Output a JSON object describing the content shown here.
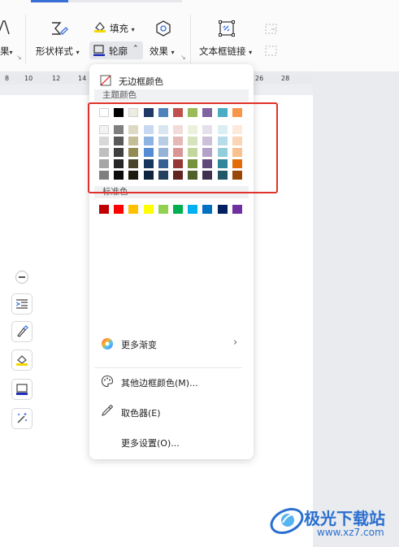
{
  "ribbon": {
    "cut_text": "果",
    "shape_style": "形状样式",
    "fill": "填充",
    "outline": "轮廓",
    "effect": "效果",
    "text_link": "文本框链接"
  },
  "ruler": {
    "numbers": [
      "8",
      "10",
      "12",
      "14",
      "28",
      "26"
    ]
  },
  "menu": {
    "no_border_color": "无边框颜色",
    "theme_colors_label": "主题颜色",
    "standard_colors_label": "标准色",
    "more_gradient": "更多渐变",
    "other_border_colors": "其他边框颜色(M)...",
    "eyedropper": "取色器(E)",
    "more_settings": "更多设置(O)..."
  },
  "theme_colors": {
    "top_row": [
      "#ffffff",
      "#000000",
      "#eeece1",
      "#1f3864",
      "#4f81bd",
      "#c0504d",
      "#9bbb59",
      "#8064a2",
      "#4bacc6",
      "#f79646"
    ],
    "shade_rows": [
      [
        "#f2f2f2",
        "#7f7f7f",
        "#ddd9c3",
        "#c6d9f0",
        "#dbe5f1",
        "#f2dcdb",
        "#ebf1dd",
        "#e5e0ec",
        "#dbeef3",
        "#fdeada"
      ],
      [
        "#d8d8d8",
        "#595959",
        "#c4bd97",
        "#8db3e2",
        "#b8cce4",
        "#e5b9b7",
        "#d7e3bc",
        "#ccc1d9",
        "#b7dde8",
        "#fbd5b5"
      ],
      [
        "#bfbfbf",
        "#3f3f3f",
        "#938953",
        "#548dd4",
        "#95b3d7",
        "#d99694",
        "#c3d69b",
        "#b2a2c7",
        "#92cddc",
        "#fac08f"
      ],
      [
        "#a5a5a5",
        "#262626",
        "#494429",
        "#17365d",
        "#366092",
        "#953734",
        "#76923c",
        "#5f497a",
        "#31859b",
        "#e36c09"
      ],
      [
        "#7f7f7f",
        "#0c0c0c",
        "#1d1b10",
        "#0f243e",
        "#244061",
        "#632423",
        "#4f6128",
        "#3f3151",
        "#205867",
        "#974806"
      ]
    ]
  },
  "standard_colors": [
    "#c00000",
    "#ff0000",
    "#ffc000",
    "#ffff00",
    "#92d050",
    "#00b050",
    "#00b0f0",
    "#0070c0",
    "#002060",
    "#7030a0"
  ],
  "watermark": {
    "brand": "极光下载站",
    "url": "www.xz7.com"
  }
}
